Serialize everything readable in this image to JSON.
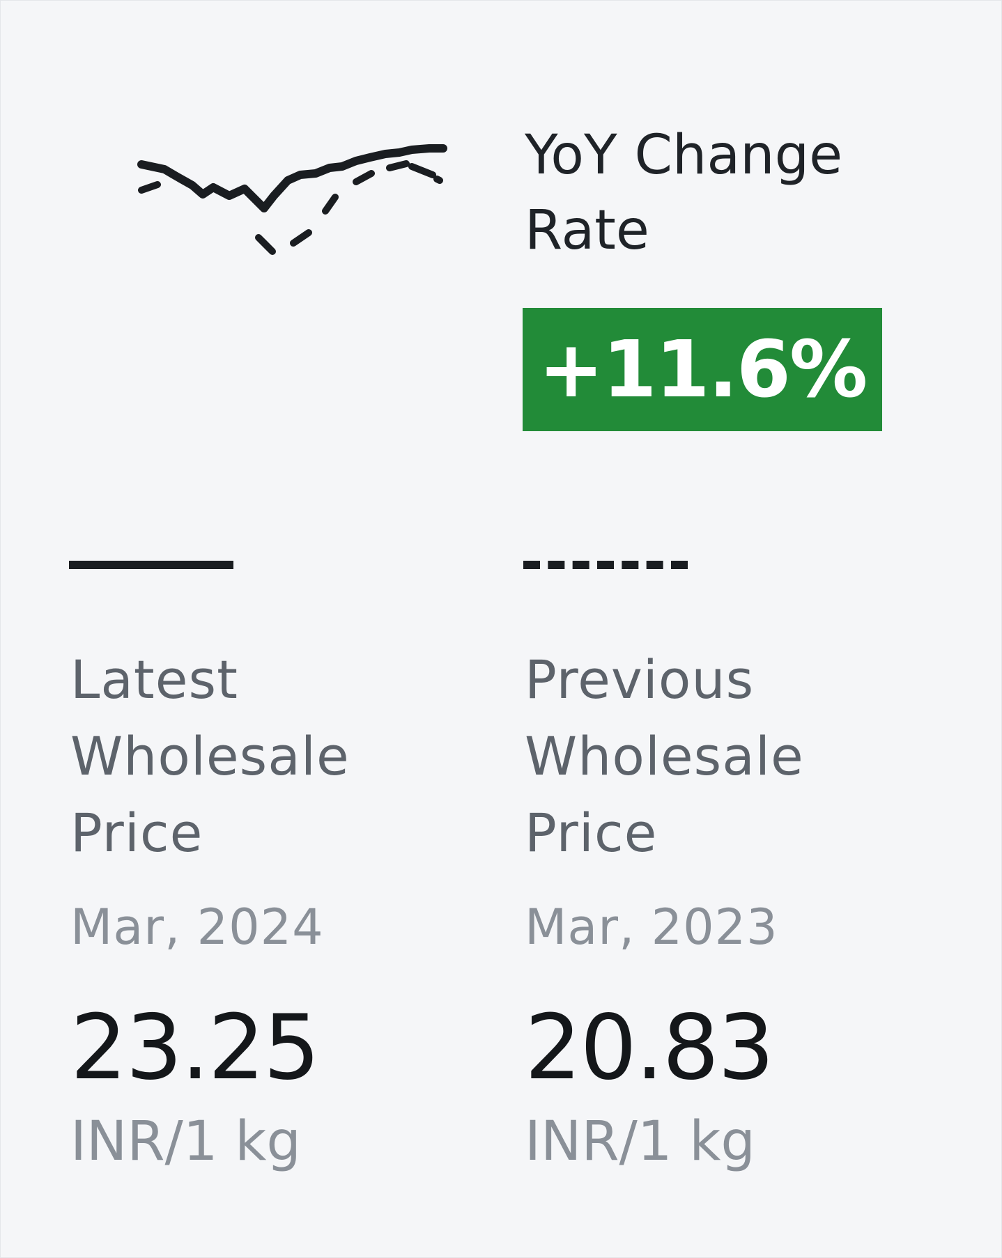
{
  "yoy": {
    "label": "YoY Change Rate",
    "value": "+11.6%",
    "badge_color": "#228b38"
  },
  "sparkline": {
    "series": [
      {
        "style": "solid",
        "color": "#1a1d21"
      },
      {
        "style": "dashed",
        "color": "#1a1d21"
      }
    ]
  },
  "latest": {
    "title": "Latest Wholesale Price",
    "date": "Mar, 2024",
    "value": "23.25",
    "unit": "INR/1 kg"
  },
  "previous": {
    "title": "Previous Wholesale Price",
    "date": "Mar, 2023",
    "value": "20.83",
    "unit": "INR/1 kg"
  }
}
